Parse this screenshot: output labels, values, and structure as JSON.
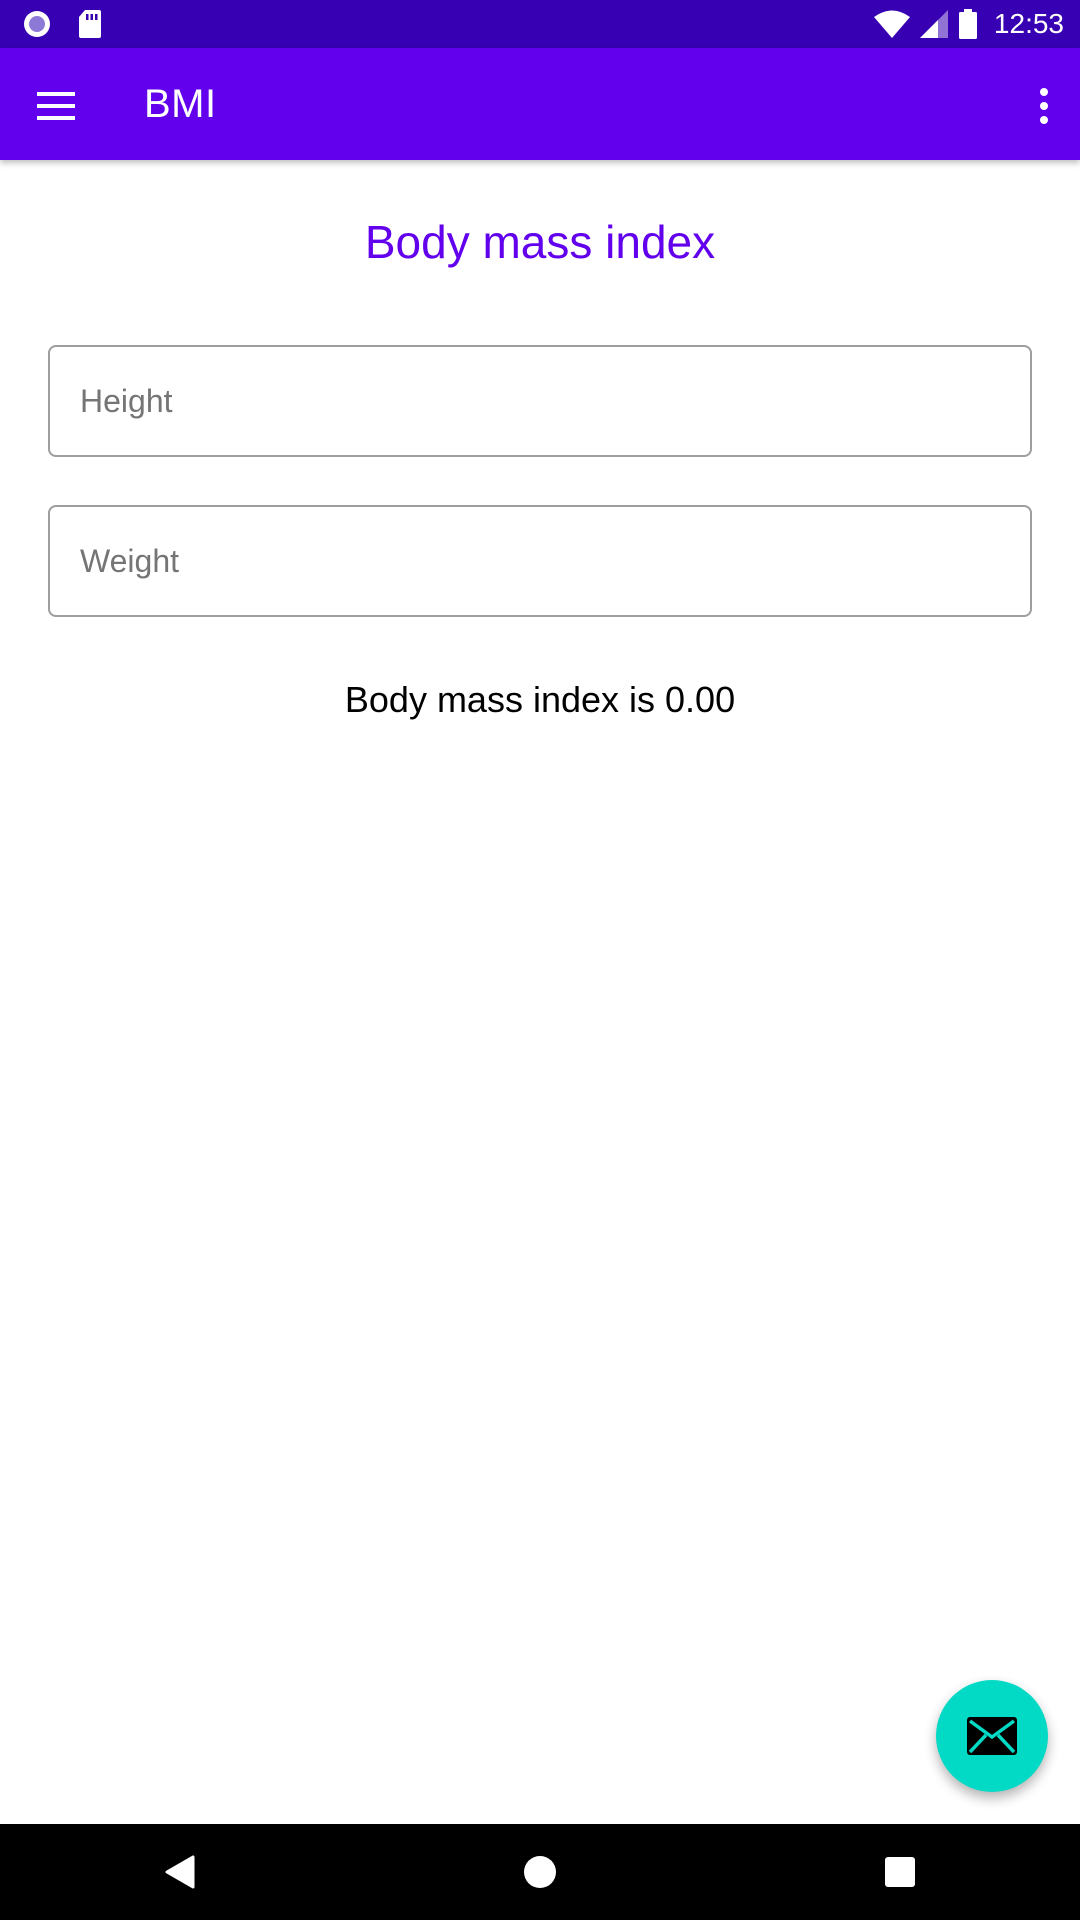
{
  "status_bar": {
    "time": "12:53",
    "icons": [
      "record-icon",
      "sd-card-icon",
      "wifi-icon",
      "cell-signal-icon",
      "battery-icon"
    ]
  },
  "app_bar": {
    "title": "BMI",
    "menu_icon": "hamburger-menu-icon",
    "overflow_icon": "more-vert-icon"
  },
  "main": {
    "page_title": "Body mass index",
    "height_field": {
      "placeholder": "Height",
      "value": ""
    },
    "weight_field": {
      "placeholder": "Weight",
      "value": ""
    },
    "result_text": "Body mass index is 0.00"
  },
  "fab": {
    "icon": "mail-icon"
  },
  "nav_bar": {
    "icons": [
      "back-icon",
      "home-icon",
      "recents-icon"
    ]
  },
  "colors": {
    "status_bar": "#3700b3",
    "app_bar": "#6200ee",
    "accent": "#6200ee",
    "fab": "#03dac5"
  }
}
